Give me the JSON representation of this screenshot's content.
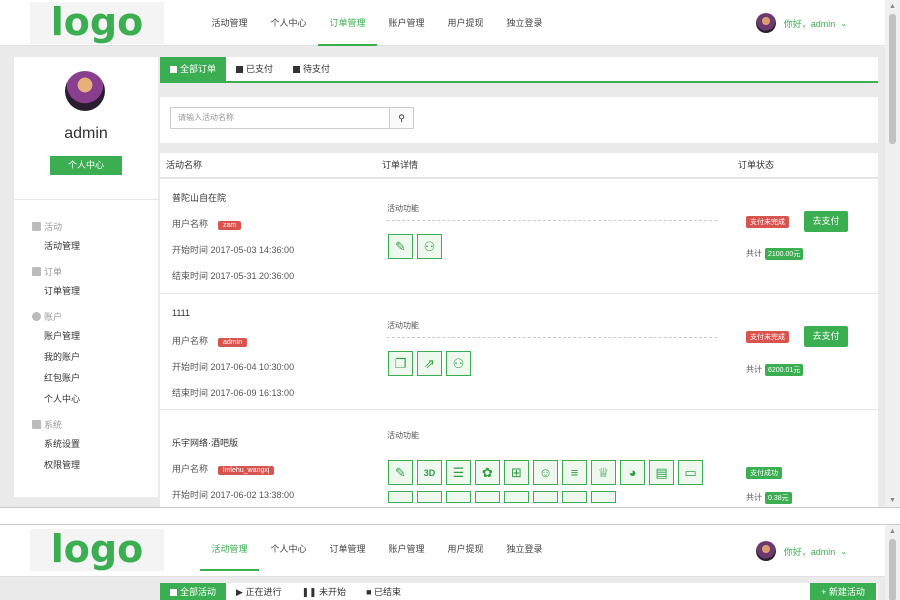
{
  "logo": "logo",
  "nav": [
    "活动管理",
    "个人中心",
    "订单管理",
    "账户管理",
    "用户提现",
    "独立登录"
  ],
  "user": {
    "greeting": "你好，admin",
    "name": "admin"
  },
  "sidebar": {
    "button": "个人中心",
    "groups": [
      {
        "title": "活动",
        "items": [
          "活动管理"
        ]
      },
      {
        "title": "订单",
        "items": [
          "订单管理"
        ]
      },
      {
        "title": "账户",
        "items": [
          "账户管理",
          "我的账户",
          "红包账户",
          "个人中心"
        ]
      },
      {
        "title": "系统",
        "items": [
          "系统设置",
          "权限管理"
        ]
      }
    ]
  },
  "tabs": [
    "全部订单",
    "已支付",
    "待支付"
  ],
  "search": {
    "placeholder": "请输入活动名称"
  },
  "table": {
    "headers": [
      "活动名称",
      "订单详情",
      "订单状态"
    ]
  },
  "rows": [
    {
      "name": "普陀山自在院",
      "user_label": "用户名称",
      "user": "zam",
      "start": "开始时间 2017-05-03 14:36:00",
      "end": "结束时间 2017-05-31 20:36:00",
      "features_label": "活动功能",
      "icons": [
        "edit-icon",
        "users-icon"
      ],
      "status": "支付未完成",
      "status_color": "#d9534f",
      "pay": "去支付",
      "total_label": "共计",
      "total": "2100.00元"
    },
    {
      "name": "1111",
      "user_label": "用户名称",
      "user": "admin",
      "start": "开始时间 2017-06-04 10:30:00",
      "end": "结束时间 2017-06-09 16:13:00",
      "features_label": "活动功能",
      "icons": [
        "cards-icon",
        "share-icon",
        "users-icon"
      ],
      "status": "支付未完成",
      "status_color": "#d9534f",
      "pay": "去支付",
      "total_label": "共计",
      "total": "6200.01元"
    },
    {
      "name": "乐宇网络·酒吧版",
      "user_label": "用户名称",
      "user": "lmlehu_wangxj",
      "start": "开始时间 2017-06-02 13:38:00",
      "features_label": "活动功能",
      "icons": [
        "edit-icon",
        "3d-icon",
        "chat-icon",
        "lottery-icon",
        "gift-icon",
        "person-icon",
        "list-icon",
        "cup-icon",
        "pie-icon",
        "stack-icon",
        "phone-icon"
      ],
      "status": "支付成功",
      "status_color": "#3cae52",
      "total_label": "共计",
      "total": "0.38元"
    }
  ],
  "frame2": {
    "tabs": [
      "全部活动",
      "正在进行",
      "未开始",
      "已结束"
    ],
    "new_button": "+ 新建活动"
  }
}
